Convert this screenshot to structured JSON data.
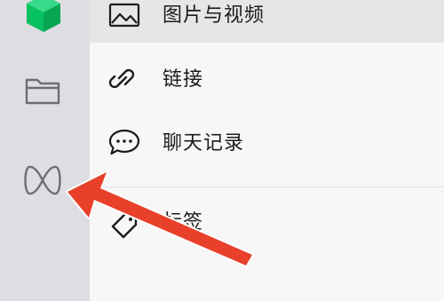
{
  "sidebar": {
    "items": [
      {
        "icon": "app-cube-icon",
        "color": "#07c160"
      },
      {
        "icon": "folder-icon"
      },
      {
        "icon": "mini-program-icon"
      }
    ]
  },
  "menu": {
    "items": [
      {
        "label": "图片与视频",
        "icon": "image-icon"
      },
      {
        "label": "链接",
        "icon": "link-icon"
      },
      {
        "label": "聊天记录",
        "icon": "chat-bubble-icon"
      },
      {
        "label": "标签",
        "icon": "tag-icon"
      }
    ]
  },
  "annotation": {
    "icon": "red-arrow-icon",
    "color": "#e8402a"
  }
}
